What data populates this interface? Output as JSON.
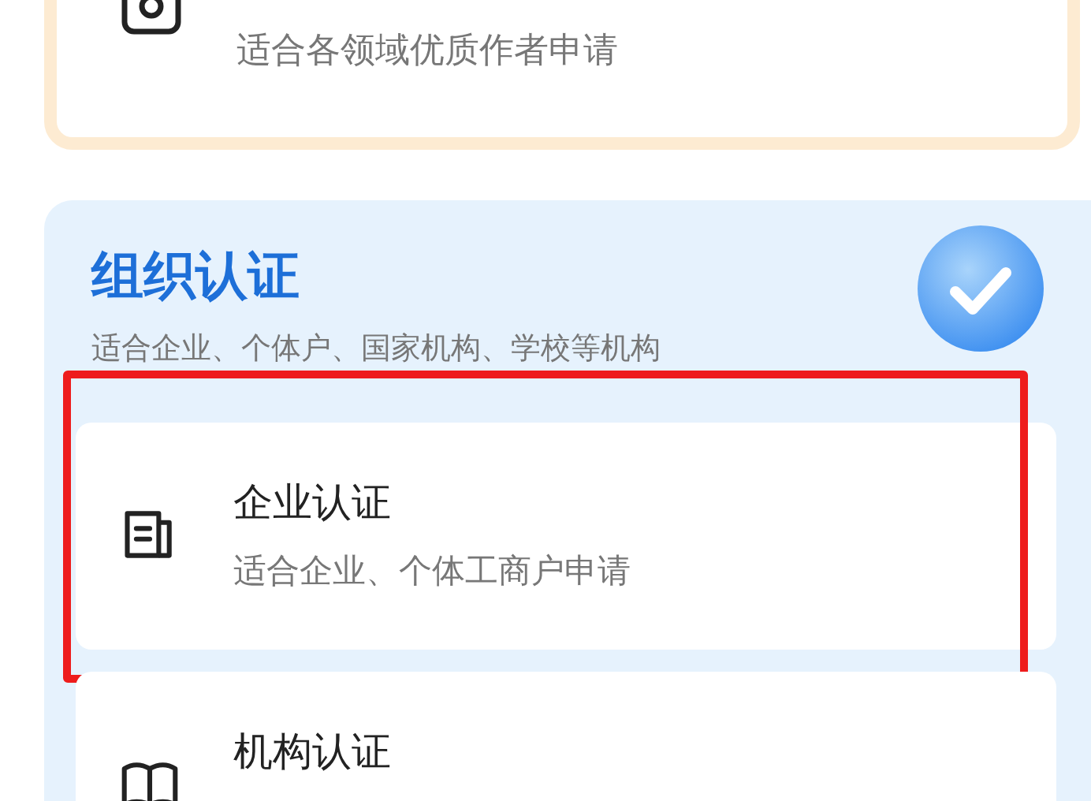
{
  "creator_card": {
    "subtitle": "适合各领域优质作者申请"
  },
  "organization": {
    "title": "组织认证",
    "subtitle": "适合企业、个体户、国家机构、学校等机构",
    "items": [
      {
        "kind": "document",
        "title": "企业认证",
        "subtitle": "适合企业、个体工商户申请",
        "highlighted": true
      },
      {
        "kind": "book",
        "title": "机构认证",
        "highlighted": false
      }
    ]
  }
}
